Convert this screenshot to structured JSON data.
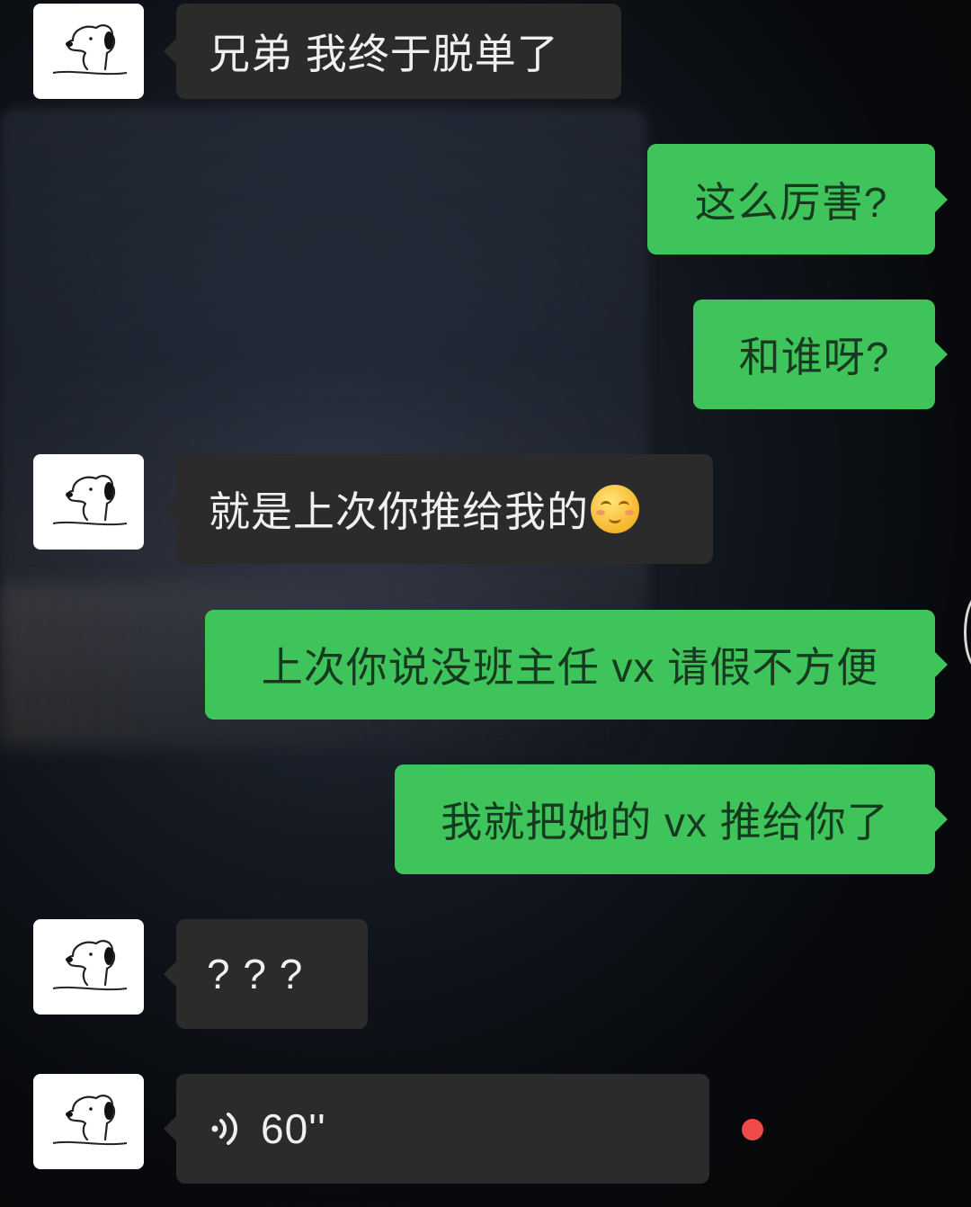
{
  "chat": {
    "messages": [
      {
        "side": "in",
        "text": "兄弟 我终于脱单了"
      },
      {
        "side": "out",
        "text": "这么厉害?"
      },
      {
        "side": "out",
        "text": "和谁呀?"
      },
      {
        "side": "in",
        "text": "就是上次你推给我的",
        "emoji": "shy-smile-emoji"
      },
      {
        "side": "out",
        "text": "上次你说没班主任 vx 请假不方便"
      },
      {
        "side": "out",
        "text": "我就把她的 vx 推给你了"
      },
      {
        "side": "in",
        "text": "? ? ?"
      },
      {
        "side": "in",
        "type": "voice",
        "duration": "60''",
        "unread": true
      }
    ]
  },
  "colors": {
    "incoming_bubble": "#2b2b2b",
    "outgoing_bubble": "#3fc45b",
    "unread_dot": "#f04a4a"
  },
  "icons": {
    "avatar": "snoopy-avatar-icon",
    "voice": "voice-wave-icon"
  }
}
